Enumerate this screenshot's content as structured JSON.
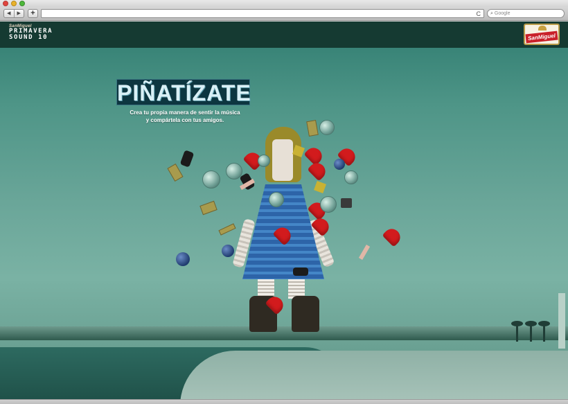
{
  "browser": {
    "back_label": "◀",
    "forward_label": "▶",
    "add_label": "+",
    "reload_label": "C",
    "search_placeholder": "Google",
    "url_value": ""
  },
  "site": {
    "brand_small": "SanMiguel",
    "logo_line1": "PRIMAVERA",
    "logo_line2": "SOUND 10",
    "badge_text": "SanMiguel"
  },
  "main": {
    "title": "PIÑATÍZATE",
    "subtitle_line1": "Crea tu propia manera de sentir la música",
    "subtitle_line2": "y compártela con tus amigos."
  },
  "colors": {
    "header_bg": "#153a32",
    "accent_red": "#d21b1d",
    "title_bg": "#0d3640"
  },
  "icons": [
    "back-icon",
    "forward-icon",
    "add-tab-icon",
    "reload-icon",
    "search-icon",
    "heart-icon",
    "disco-ball-icon",
    "cassette-icon",
    "sneaker-icon",
    "camera-icon"
  ]
}
